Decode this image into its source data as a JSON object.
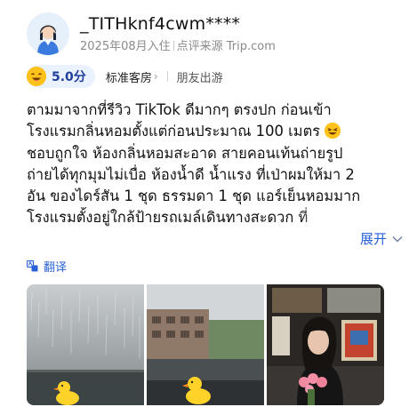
{
  "user": {
    "name": "_TITHknf4cwm****",
    "join_date": "2025年08月入住",
    "source": "点评来源 Trip.com"
  },
  "rating": {
    "score": "5.0分",
    "room_type": "标准客房",
    "trip_type": "朋友出游"
  },
  "review": {
    "lines": [
      "ตามมาจากที่รีวิว TikTok ดีมากๆ ตรงปก ก่อนเข้า",
      "โรงแรมกลิ่นหอมตั้งแต่ก่อนประมาณ 100 เมตร",
      "ชอบถูกใจ ห้องกลิ่นหอมสะอาด สายคอนเท้นถ่ายรูป",
      "ถ่ายได้ทุกมุมไม่เบื่อ ห้องน้ำดี น้ำแรง ที่เป่าผมให้มา 2",
      "อัน ของไดร์สัน 1 ชุด ธรรมดา 1 ชุด แอร์เย็นหอมมาก",
      "โรงแรมตั้งอยู่ใกล้ป้ายรถเมล์เดินทางสะดวก ที่"
    ],
    "expand_label": "展开",
    "translate_label": "翻译"
  },
  "photos": [
    {
      "name": "photo-rainy-window"
    },
    {
      "name": "photo-duck-window-view"
    },
    {
      "name": "photo-woman-with-roses"
    }
  ],
  "colors": {
    "accent_blue": "#2a62d8",
    "score_pill_bg": "#eaf1ff",
    "score_text": "#1f3f9a",
    "emoji_yellow": "#ffc21a"
  }
}
